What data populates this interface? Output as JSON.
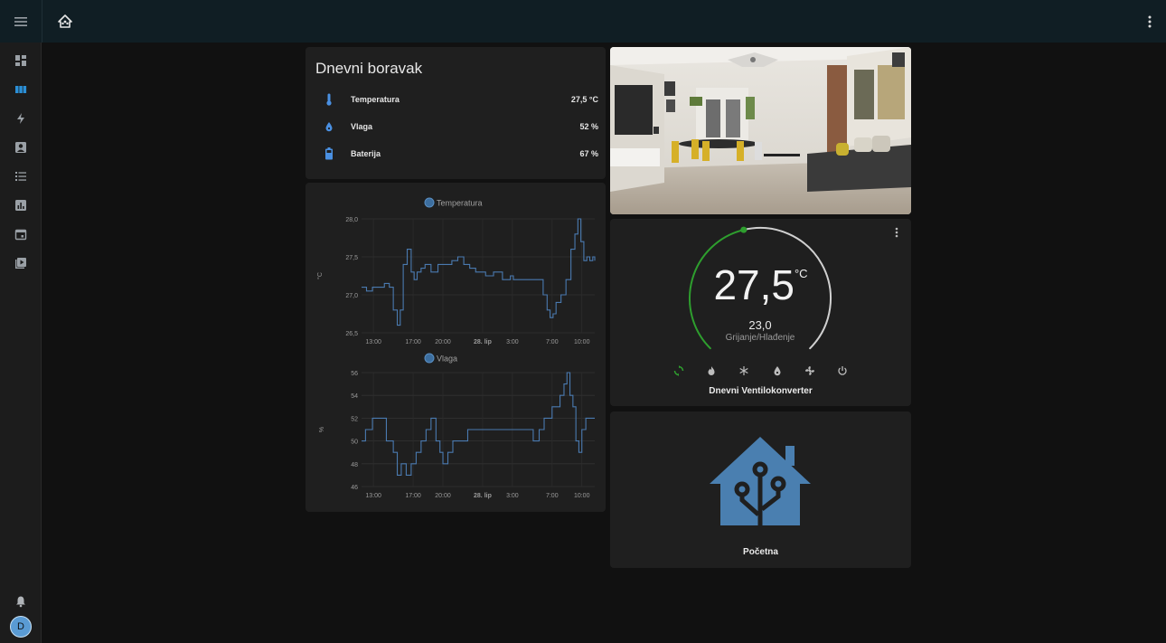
{
  "header": {
    "menu_icon": "menu-icon",
    "tab_icon": "home-assistant-icon",
    "more_icon": "dots-vertical-icon"
  },
  "sidebar": {
    "items": [
      {
        "name": "overview",
        "icon": "view-dashboard-icon"
      },
      {
        "name": "dashboard",
        "icon": "view-column-icon"
      },
      {
        "name": "energy",
        "icon": "flash-icon"
      },
      {
        "name": "map",
        "icon": "account-box-icon"
      },
      {
        "name": "logbook",
        "icon": "format-list-icon"
      },
      {
        "name": "history",
        "icon": "chart-box-icon"
      },
      {
        "name": "calendar",
        "icon": "calendar-icon"
      },
      {
        "name": "media",
        "icon": "play-box-multiple-icon"
      }
    ],
    "notifications_icon": "bell-icon",
    "user_initial": "D"
  },
  "sensor_card": {
    "title": "Dnevni boravak",
    "rows": [
      {
        "name": "Temperatura",
        "value": "27,5 °C",
        "icon": "thermometer-icon"
      },
      {
        "name": "Vlaga",
        "value": "52 %",
        "icon": "water-percent-icon"
      },
      {
        "name": "Baterija",
        "value": "67 %",
        "icon": "battery-icon"
      }
    ]
  },
  "chart_data": [
    {
      "type": "line",
      "title": "Temperatura",
      "ylabel": "°C",
      "ylim": [
        26.5,
        28.0
      ],
      "y_ticks": [
        "28,0",
        "27,5",
        "27,0",
        "26,5"
      ],
      "x_ticks": [
        "13:00",
        "17:00",
        "20:00",
        "28. lip",
        "3:00",
        "7:00",
        "10:00"
      ],
      "series": [
        {
          "name": "Temperatura",
          "step": true,
          "x": [
            11.8,
            12.3,
            12.9,
            13.5,
            14.1,
            14.6,
            15.0,
            15.4,
            15.7,
            16.0,
            16.4,
            16.8,
            17.1,
            17.4,
            17.8,
            18.2,
            18.8,
            19.5,
            20.3,
            20.9,
            21.5,
            22.1,
            22.7,
            23.3,
            23.8,
            24.3,
            25.1,
            26.0,
            26.4,
            26.8,
            27.1,
            27.5,
            28.1,
            28.8,
            29.5,
            30.1,
            30.5,
            30.8,
            31.1,
            31.4,
            31.9,
            32.4,
            32.9,
            33.3,
            33.6,
            33.9,
            34.2,
            34.5,
            34.8,
            35.1,
            35.3
          ],
          "y": [
            27.1,
            27.05,
            27.1,
            27.1,
            27.15,
            27.1,
            26.8,
            26.6,
            26.8,
            27.4,
            27.6,
            27.3,
            27.2,
            27.3,
            27.35,
            27.4,
            27.3,
            27.4,
            27.4,
            27.45,
            27.5,
            27.4,
            27.35,
            27.3,
            27.3,
            27.25,
            27.3,
            27.2,
            27.2,
            27.25,
            27.2,
            27.2,
            27.2,
            27.2,
            27.2,
            27.0,
            26.8,
            26.7,
            26.75,
            26.9,
            27.0,
            27.2,
            27.6,
            27.8,
            28.0,
            27.7,
            27.45,
            27.5,
            27.45,
            27.5,
            27.45
          ]
        }
      ]
    },
    {
      "type": "line",
      "title": "Vlaga",
      "ylabel": "%",
      "ylim": [
        46,
        56
      ],
      "y_ticks": [
        "56",
        "54",
        "52",
        "50",
        "48",
        "46"
      ],
      "x_ticks": [
        "13:00",
        "17:00",
        "20:00",
        "28. lip",
        "3:00",
        "7:00",
        "10:00"
      ],
      "series": [
        {
          "name": "Vlaga",
          "step": true,
          "x": [
            11.8,
            12.2,
            12.9,
            13.5,
            14.3,
            15.0,
            15.4,
            15.8,
            16.3,
            16.8,
            17.3,
            17.8,
            18.3,
            18.8,
            19.3,
            19.7,
            20.0,
            20.5,
            21.0,
            21.7,
            22.5,
            23.4,
            24.3,
            25.1,
            25.9,
            26.7,
            27.5,
            28.3,
            29.1,
            29.7,
            30.2,
            30.6,
            31.0,
            31.4,
            31.8,
            32.2,
            32.5,
            32.8,
            33.1,
            33.4,
            33.7,
            34.0,
            34.4,
            34.8,
            35.2
          ],
          "y": [
            50,
            51,
            52,
            52,
            50,
            49,
            47,
            48,
            47,
            48,
            49,
            50,
            51,
            52,
            50,
            49,
            48,
            49,
            50,
            50,
            51,
            51,
            51,
            51,
            51,
            51,
            51,
            51,
            50,
            51,
            52,
            52,
            53,
            53,
            54,
            55,
            56,
            54,
            53,
            50,
            49,
            51,
            52,
            52,
            52
          ]
        }
      ]
    }
  ],
  "thermostat": {
    "current": "27,5",
    "unit": "°C",
    "target": "23,0",
    "mode": "Grijanje/Hlađenje",
    "name": "Dnevni Ventilokonverter",
    "arc_fraction": 0.45,
    "active_color": "#2e9e2e",
    "modes": [
      "heat-cool-icon",
      "fire-icon",
      "snowflake-icon",
      "water-icon",
      "fan-icon",
      "power-icon"
    ],
    "more_icon": "dots-vertical-icon"
  },
  "picture_card": {
    "icon": "living-room-photo"
  },
  "home_card": {
    "name": "Početna",
    "icon": "home-assistant-logo-icon",
    "color": "#4a7fb0"
  }
}
